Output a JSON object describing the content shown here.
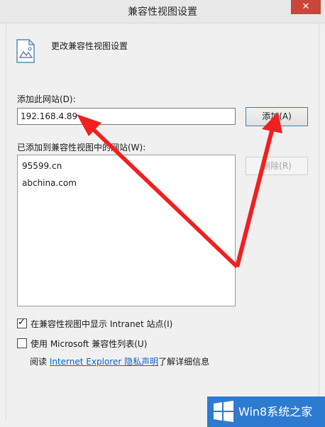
{
  "window": {
    "title": "兼容性视图设置",
    "close_label": "✕"
  },
  "header": {
    "icon": "document-image-icon",
    "text": "更改兼容性视图设置"
  },
  "add_site": {
    "label": "添加此网站(D):",
    "value": "192.168.4.89",
    "add_button": "添加(A)"
  },
  "added_sites": {
    "label": "已添加到兼容性视图中的网站(W):",
    "items": [
      "95599.cn",
      "abchina.com"
    ],
    "remove_button": "删除(R)"
  },
  "options": {
    "show_intranet": {
      "label": "在兼容性视图中显示 Intranet 站点(I)",
      "checked": true
    },
    "use_ms_list": {
      "label": "使用 Microsoft 兼容性列表(U)",
      "checked": false
    }
  },
  "privacy": {
    "prefix": "阅读 ",
    "link": "Internet Explorer 隐私声明",
    "suffix": "了解详细信息"
  },
  "watermark": {
    "text": "Win8系统之家",
    "icon": "windows-logo-icon"
  },
  "colors": {
    "annotation_arrow": "#f21f1f",
    "link": "#0b63c7",
    "watermark_bg": "#2d7bd1",
    "close_button": "#c7473b"
  }
}
